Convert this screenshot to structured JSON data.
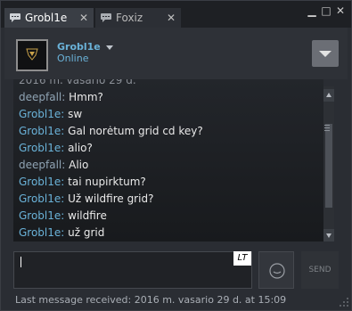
{
  "tabs": [
    {
      "label": "Grobl1e",
      "active": true
    },
    {
      "label": "Foxiz",
      "active": false
    }
  ],
  "window_controls": {
    "minimize": "▁",
    "maximize": "□",
    "close": "✕"
  },
  "header": {
    "username": "Grobl1e",
    "status": "Online",
    "avatar_icon": "emblem-icon"
  },
  "messages": [
    {
      "who": "2016 m. vasario 29 d.",
      "text": "",
      "kind": "clipped"
    },
    {
      "who": "deepfall",
      "text": "Hmm?",
      "kind": "them"
    },
    {
      "who": "Grobl1e",
      "text": "sw",
      "kind": "me"
    },
    {
      "who": "Grobl1e",
      "text": "Gal norėtum grid cd key?",
      "kind": "me"
    },
    {
      "who": "Grobl1e",
      "text": "alio?",
      "kind": "me"
    },
    {
      "who": "deepfall",
      "text": "Alio",
      "kind": "them"
    },
    {
      "who": "Grobl1e",
      "text": "tai nupirktum?",
      "kind": "me"
    },
    {
      "who": "Grobl1e",
      "text": "Už wildfire grid?",
      "kind": "me"
    },
    {
      "who": "Grobl1e",
      "text": "wildfire",
      "kind": "me"
    },
    {
      "who": "Grobl1e",
      "text": "už grid",
      "kind": "me"
    }
  ],
  "input": {
    "value": "",
    "language_indicator": "LT"
  },
  "send_label": "SEND",
  "footer": {
    "last_message": "Last message received: 2016 m. vasario 29 d. at 15:09"
  },
  "colors": {
    "accent": "#6ab2d8",
    "background": "#2a2d33"
  }
}
